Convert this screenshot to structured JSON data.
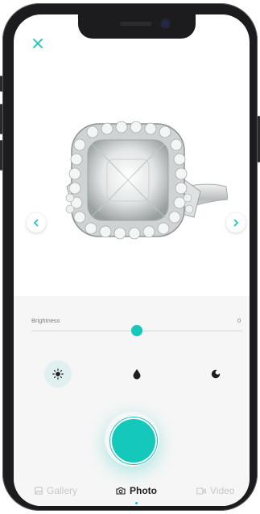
{
  "colors": {
    "accent": "#14c8bc",
    "dark_frame": "#1c1c1e",
    "panel_bg": "#f6f6f6"
  },
  "topbar": {
    "close_icon": "close-icon"
  },
  "viewer": {
    "image": "diamond-ring-photo",
    "prev_icon": "chevron-left-icon",
    "next_icon": "chevron-right-icon"
  },
  "brightness": {
    "label": "Brightness",
    "value": "0",
    "level": 0.5
  },
  "tools": [
    {
      "icon": "sun-icon",
      "active": true
    },
    {
      "icon": "drop-icon",
      "active": false
    },
    {
      "icon": "contrast-icon",
      "active": false
    }
  ],
  "shutter": {
    "icon": "shutter-button"
  },
  "tabs": [
    {
      "label": "Gallery",
      "icon": "gallery-icon",
      "active": false
    },
    {
      "label": "Photo",
      "icon": "camera-icon",
      "active": true
    },
    {
      "label": "Video",
      "icon": "video-icon",
      "active": false
    }
  ]
}
